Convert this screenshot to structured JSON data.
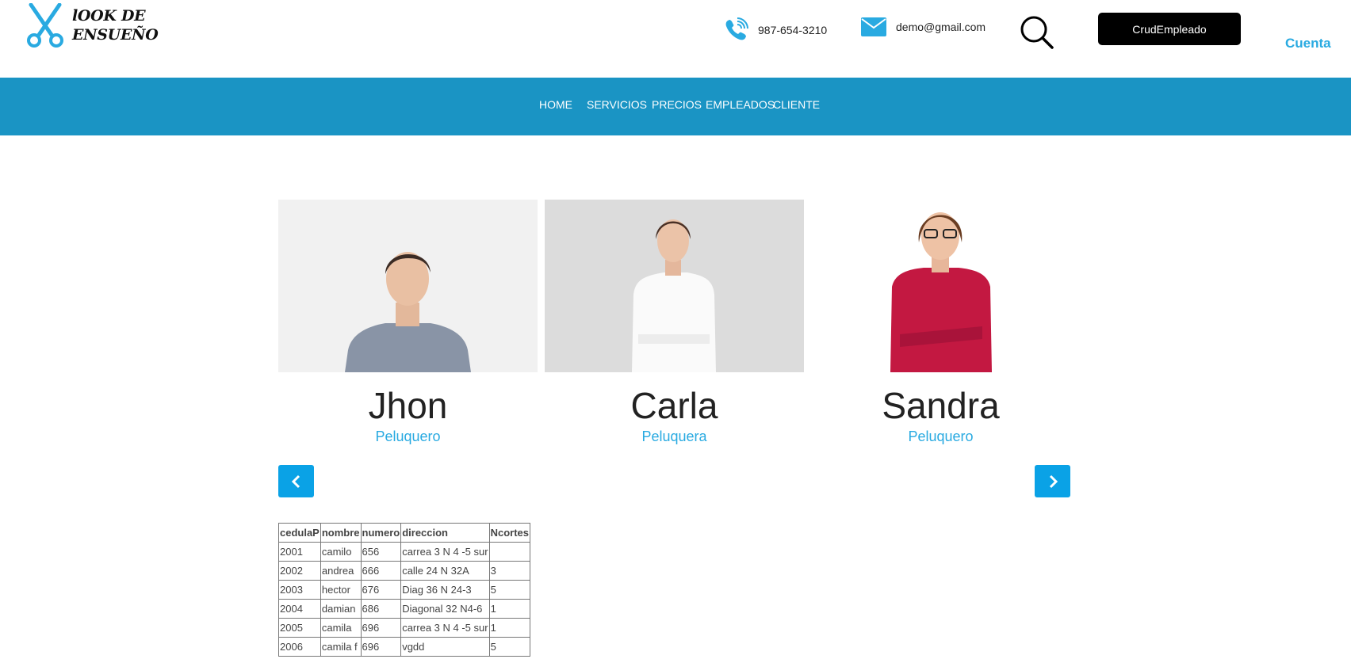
{
  "brand": {
    "line1": "lOOK DE",
    "line2": "ENSUEÑO"
  },
  "contact": {
    "phone": "987-654-3210",
    "email": "demo@gmail.com"
  },
  "header": {
    "crud_label": "CrudEmpleado",
    "account_label": "Cuenta"
  },
  "nav": {
    "items": [
      {
        "label": "HOME"
      },
      {
        "label": "SERVICIOS"
      },
      {
        "label": "PRECIOS"
      },
      {
        "label": "EMPLEADOS"
      },
      {
        "label": "CLIENTE"
      }
    ]
  },
  "employees": [
    {
      "name": "Jhon",
      "role": "Peluquero"
    },
    {
      "name": "Carla",
      "role": "Peluquera"
    },
    {
      "name": "Sandra",
      "role": "Peluquero"
    }
  ],
  "colors": {
    "accent": "#29aae1",
    "nav_bg": "#1a94c4",
    "arrow_bg": "#0aa2e6"
  },
  "icons": {
    "logo": "scissors-icon",
    "phone": "phone-icon",
    "mail": "mail-icon",
    "search": "search-icon",
    "prev": "chevron-left-icon",
    "next": "chevron-right-icon"
  },
  "table": {
    "headers": [
      "cedulaP",
      "nombre",
      "numero",
      "direccion",
      "Ncortes"
    ],
    "rows": [
      [
        "2001",
        "camilo",
        "656",
        "carrea 3 N 4 -5 sur",
        ""
      ],
      [
        "2002",
        "andrea",
        "666",
        "calle 24 N 32A",
        "3"
      ],
      [
        "2003",
        "hector",
        "676",
        "Diag 36 N 24-3",
        "5"
      ],
      [
        "2004",
        "damian",
        "686",
        "Diagonal 32 N4-6",
        "1"
      ],
      [
        "2005",
        "camila",
        "696",
        "carrea 3 N 4 -5 sur",
        "1"
      ],
      [
        "2006",
        "camila f",
        "696",
        "vgdd",
        "5"
      ]
    ]
  }
}
